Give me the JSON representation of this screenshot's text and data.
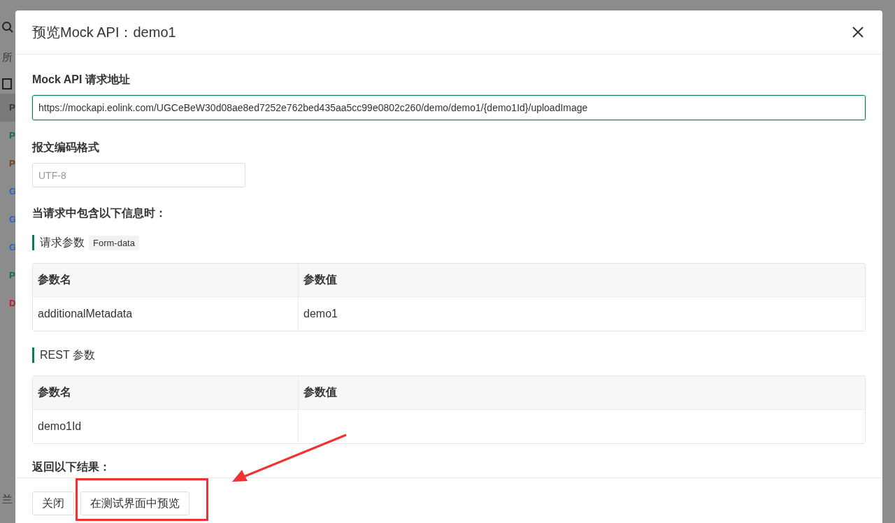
{
  "background": {
    "sidebar_label": "所",
    "method_tags": [
      {
        "text": "P",
        "color": "#333333",
        "selected": true
      },
      {
        "text": "P",
        "color": "#0a6e4a",
        "selected": false
      },
      {
        "text": "P",
        "color": "#7a3b1e",
        "selected": false
      },
      {
        "text": "G",
        "color": "#2b5ad1",
        "selected": false
      },
      {
        "text": "G",
        "color": "#2b5ad1",
        "selected": false
      },
      {
        "text": "G",
        "color": "#2b5ad1",
        "selected": false
      },
      {
        "text": "P",
        "color": "#0a6e4a",
        "selected": false
      },
      {
        "text": "D",
        "color": "#c0191f",
        "selected": false
      }
    ],
    "bottom_label": "兰"
  },
  "dialog": {
    "title": "预览Mock API：demo1",
    "url_label": "Mock API 请求地址",
    "url": "https://mockapi.eolink.com/UGCeBeW30d08ae8ed7252e762bed435aa5cc99e0802c260/demo/demo1/{demo1Id}/uploadImage",
    "encoding_label": "报文编码格式",
    "encoding_placeholder": "UTF-8",
    "condition_label": "当请求中包含以下信息时：",
    "sections": [
      {
        "title": "请求参数",
        "tag": "Form-data",
        "columns": [
          "参数名",
          "参数值"
        ],
        "rows": [
          [
            "additionalMetadata",
            "demo1"
          ]
        ]
      },
      {
        "title": "REST 参数",
        "columns": [
          "参数名",
          "参数值"
        ],
        "rows": [
          [
            "demo1Id",
            ""
          ]
        ]
      }
    ],
    "result_label": "返回以下结果：",
    "buttons": [
      "关闭",
      "在测试界面中预览"
    ]
  }
}
